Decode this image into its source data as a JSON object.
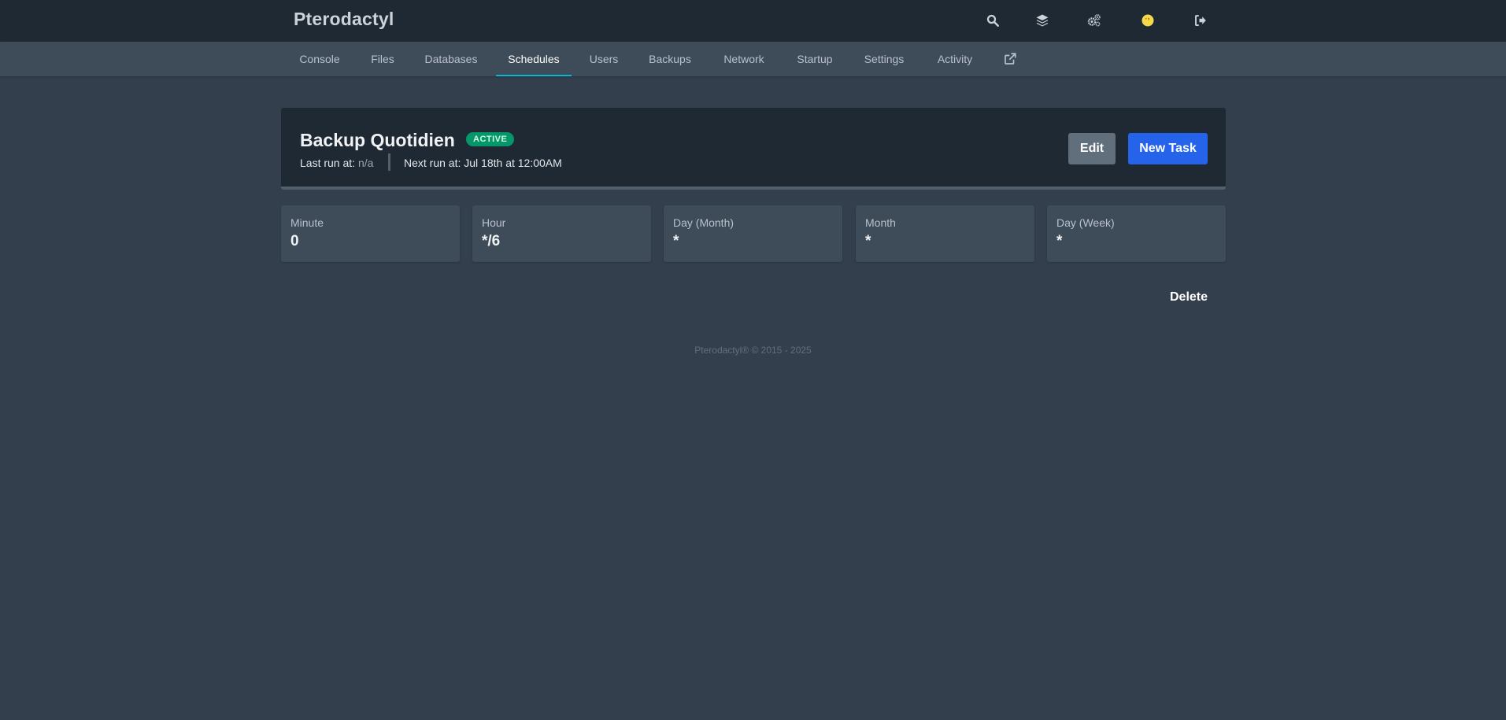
{
  "app": {
    "brand": "Pterodactyl"
  },
  "topbar": {
    "icons": [
      "search-icon",
      "layers-icon",
      "cogs-icon",
      "avatar",
      "sign-out-icon"
    ],
    "avatar_color": "#f5d94a"
  },
  "nav": {
    "tabs": [
      {
        "label": "Console"
      },
      {
        "label": "Files"
      },
      {
        "label": "Databases"
      },
      {
        "label": "Schedules",
        "active": true
      },
      {
        "label": "Users"
      },
      {
        "label": "Backups"
      },
      {
        "label": "Network"
      },
      {
        "label": "Startup"
      },
      {
        "label": "Settings"
      },
      {
        "label": "Activity"
      }
    ],
    "external_icon": "external-link-icon",
    "active_color": "#06b6d4"
  },
  "schedule": {
    "title": "Backup Quotidien",
    "status": "ACTIVE",
    "last_run_label": "Last run at:",
    "last_run_value": "n/a",
    "next_run_label": "Next run at:",
    "next_run_value": "Jul 18th at 12:00AM",
    "edit_label": "Edit",
    "new_task_label": "New Task",
    "status_color": "#059669",
    "primary_color": "#2563eb"
  },
  "cron": [
    {
      "label": "Minute",
      "value": "0"
    },
    {
      "label": "Hour",
      "value": "*/6"
    },
    {
      "label": "Day (Month)",
      "value": "*"
    },
    {
      "label": "Month",
      "value": "*"
    },
    {
      "label": "Day (Week)",
      "value": "*"
    }
  ],
  "actions": {
    "delete_label": "Delete"
  },
  "footer": {
    "text": "Pterodactyl® © 2015 - 2025"
  }
}
